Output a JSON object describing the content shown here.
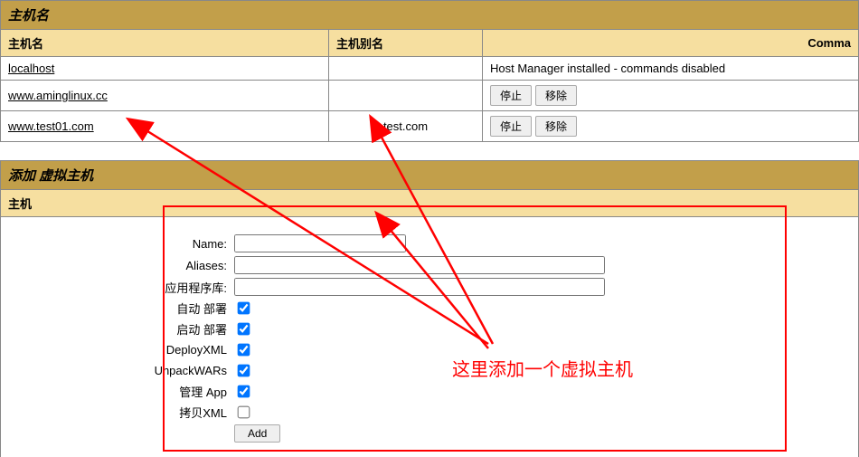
{
  "table1": {
    "title": "主机名",
    "columns": {
      "c1": "主机名",
      "c2": "主机别名",
      "c3": "Comma"
    },
    "rows": [
      {
        "name": "localhost",
        "alias": "",
        "cmd_text": "Host Manager installed - commands disabled",
        "has_buttons": false
      },
      {
        "name": "www.aminglinux.cc",
        "alias": "",
        "cmd_text": "",
        "has_buttons": true
      },
      {
        "name": "www.test01.com",
        "alias": "test.com",
        "cmd_text": "",
        "has_buttons": true
      }
    ],
    "btn_stop": "停止",
    "btn_remove": "移除"
  },
  "table2": {
    "title": "添加 虚拟主机",
    "subtitle": "主机",
    "form": {
      "name_label": "Name:",
      "name_value": "",
      "aliases_label": "Aliases:",
      "aliases_value": "",
      "appbase_label": "应用程序库:",
      "appbase_value": "",
      "autodeploy_label": "自动 部署",
      "autodeploy_checked": true,
      "startdeploy_label": "启动 部署",
      "startdeploy_checked": true,
      "deployxml_label": "DeployXML",
      "deployxml_checked": true,
      "unpackwars_label": "UnpackWARs",
      "unpackwars_checked": true,
      "manageapp_label": "管理 App",
      "manageapp_checked": true,
      "copyxml_label": "拷贝XML",
      "copyxml_checked": false,
      "add_button": "Add"
    }
  },
  "annotation": {
    "text": "这里添加一个虚拟主机"
  }
}
